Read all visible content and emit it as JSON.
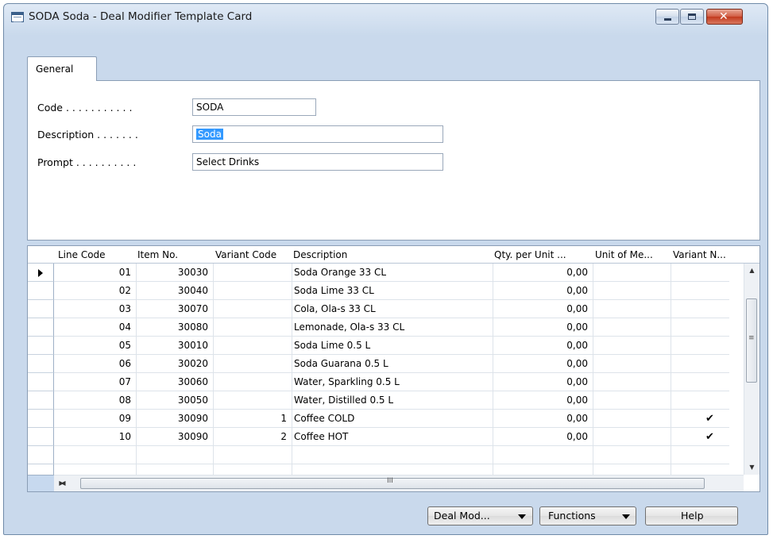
{
  "window": {
    "title": "SODA Soda - Deal Modifier Template Card",
    "icons": {
      "app": "card-icon",
      "minimize": "minimize-icon",
      "maximize": "maximize-icon",
      "close": "close-icon"
    }
  },
  "tab": {
    "label": "General"
  },
  "form": {
    "code": {
      "label": "Code . . . . . . . . . . .",
      "value": "SODA"
    },
    "description": {
      "label": "Description . . . . . . .",
      "value": "Soda"
    },
    "prompt": {
      "label": "Prompt . . . . . . . . . .",
      "value": "Select Drinks"
    }
  },
  "table": {
    "headers": [
      "Line Code",
      "Item No.",
      "Variant Code",
      "Description",
      "Qty. per Unit ...",
      "Unit of Me...",
      "Variant N..."
    ],
    "rows": [
      {
        "line": "01",
        "item": "30030",
        "variant": "",
        "desc": "Soda Orange 33 CL",
        "qty": "0,00",
        "uom": "",
        "vn": ""
      },
      {
        "line": "02",
        "item": "30040",
        "variant": "",
        "desc": "Soda Lime 33 CL",
        "qty": "0,00",
        "uom": "",
        "vn": ""
      },
      {
        "line": "03",
        "item": "30070",
        "variant": "",
        "desc": "Cola, Ola-s 33 CL",
        "qty": "0,00",
        "uom": "",
        "vn": ""
      },
      {
        "line": "04",
        "item": "30080",
        "variant": "",
        "desc": "Lemonade, Ola-s 33 CL",
        "qty": "0,00",
        "uom": "",
        "vn": ""
      },
      {
        "line": "05",
        "item": "30010",
        "variant": "",
        "desc": "Soda Lime 0.5 L",
        "qty": "0,00",
        "uom": "",
        "vn": ""
      },
      {
        "line": "06",
        "item": "30020",
        "variant": "",
        "desc": "Soda Guarana 0.5 L",
        "qty": "0,00",
        "uom": "",
        "vn": ""
      },
      {
        "line": "07",
        "item": "30060",
        "variant": "",
        "desc": "Water, Sparkling 0.5 L",
        "qty": "0,00",
        "uom": "",
        "vn": ""
      },
      {
        "line": "08",
        "item": "30050",
        "variant": "",
        "desc": "Water, Distilled 0.5 L",
        "qty": "0,00",
        "uom": "",
        "vn": ""
      },
      {
        "line": "09",
        "item": "30090",
        "variant": "1",
        "desc": "Coffee COLD",
        "qty": "0,00",
        "uom": "",
        "vn": "✔"
      },
      {
        "line": "10",
        "item": "30090",
        "variant": "2",
        "desc": "Coffee HOT",
        "qty": "0,00",
        "uom": "",
        "vn": "✔"
      }
    ],
    "current_row": 0,
    "scrollbar_glyph": "≡",
    "hscroll_glyph": "III"
  },
  "buttons": {
    "deal_mod": "Deal Mod...",
    "functions": "Functions",
    "help": "Help"
  }
}
